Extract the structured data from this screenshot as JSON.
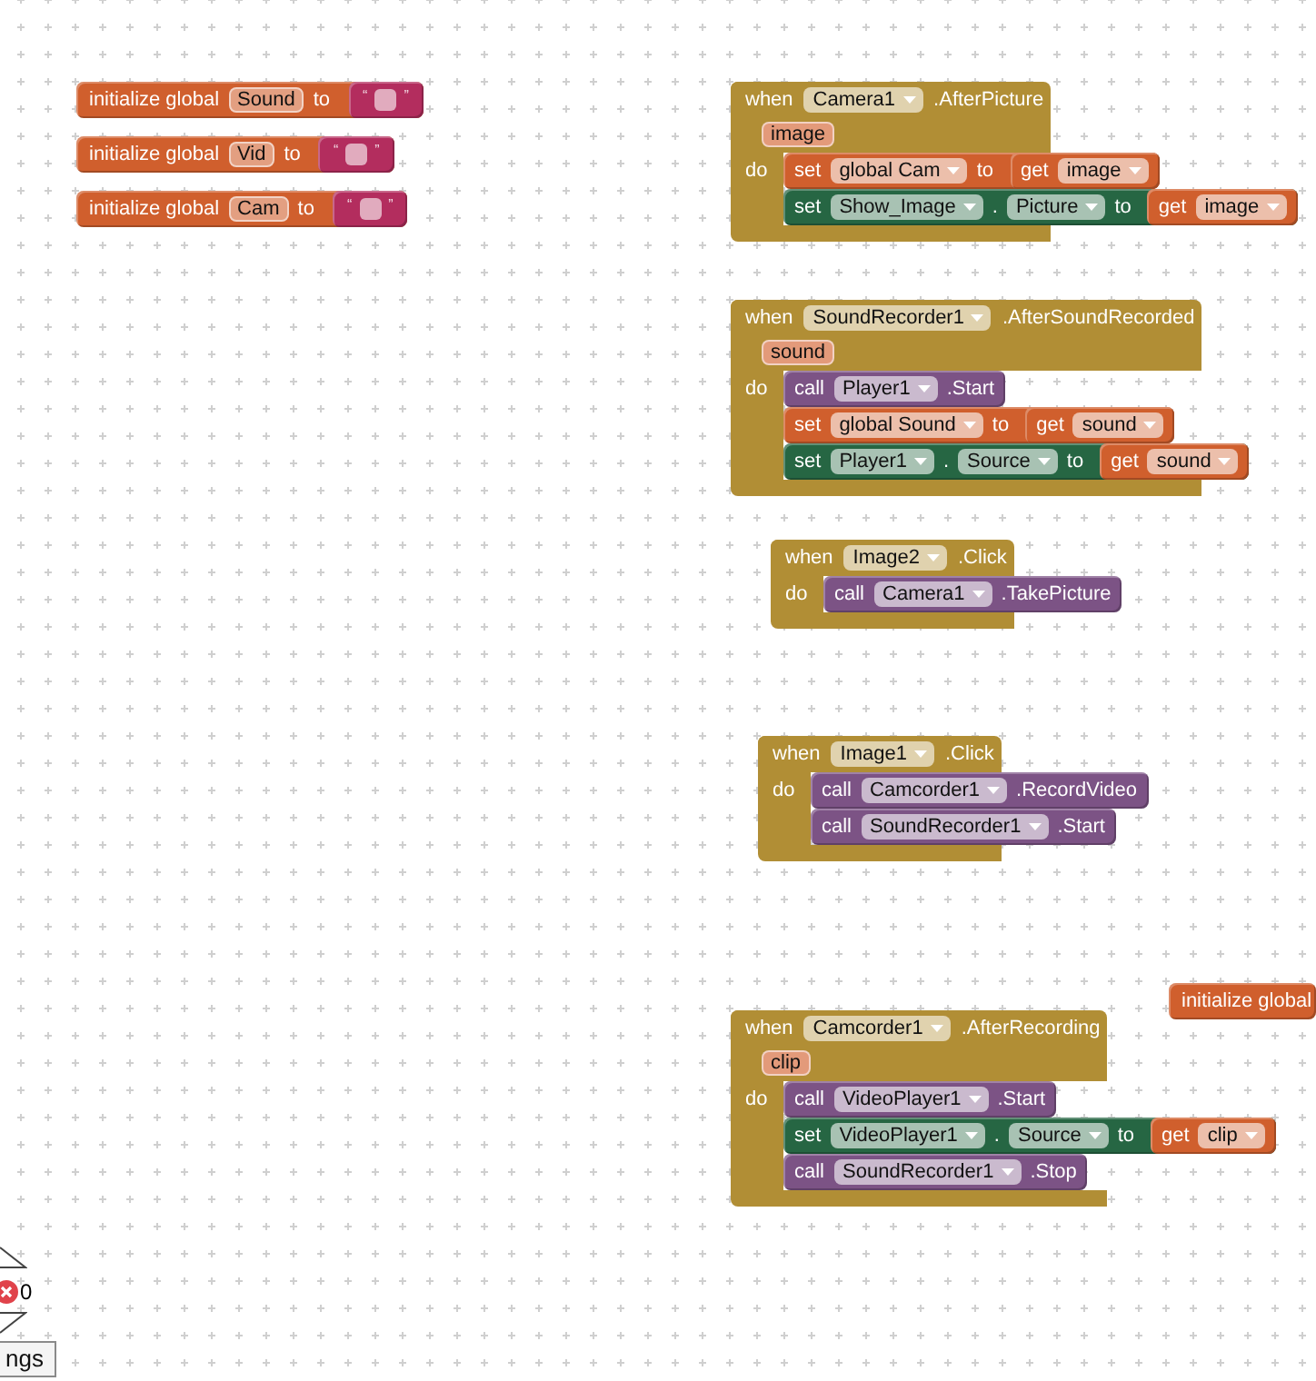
{
  "global_variables": [
    {
      "label": "initialize global",
      "name": "Sound",
      "to": "to",
      "value": {
        "open_quote": "“",
        "close_quote": "”"
      }
    },
    {
      "label": "initialize global",
      "name": "Vid",
      "to": "to",
      "value": {
        "open_quote": "“",
        "close_quote": "”"
      }
    },
    {
      "label": "initialize global",
      "name": "Cam",
      "to": "to",
      "value": {
        "open_quote": "“",
        "close_quote": "”"
      }
    },
    {
      "label": "initialize global"
    }
  ],
  "event_handlers": [
    {
      "when": "when",
      "component": "Camera1",
      "event": ".AfterPicture",
      "params": [
        "image"
      ],
      "do": "do",
      "statements": [
        {
          "kind": "set_global",
          "keyword": "set",
          "variable": "global Cam",
          "to": "to",
          "value": {
            "keyword": "get",
            "variable": "image"
          }
        },
        {
          "kind": "set_property",
          "keyword": "set",
          "component": "Show_Image",
          "dot": ".",
          "property": "Picture",
          "to": "to",
          "value": {
            "keyword": "get",
            "variable": "image"
          }
        }
      ]
    },
    {
      "when": "when",
      "component": "SoundRecorder1",
      "event": ".AfterSoundRecorded",
      "params": [
        "sound"
      ],
      "do": "do",
      "statements": [
        {
          "kind": "call",
          "keyword": "call",
          "component": "Player1",
          "method": ".Start"
        },
        {
          "kind": "set_global",
          "keyword": "set",
          "variable": "global Sound",
          "to": "to",
          "value": {
            "keyword": "get",
            "variable": "sound"
          }
        },
        {
          "kind": "set_property",
          "keyword": "set",
          "component": "Player1",
          "dot": ".",
          "property": "Source",
          "to": "to",
          "value": {
            "keyword": "get",
            "variable": "sound"
          }
        }
      ]
    },
    {
      "when": "when",
      "component": "Image2",
      "event": ".Click",
      "do": "do",
      "statements": [
        {
          "kind": "call",
          "keyword": "call",
          "component": "Camera1",
          "method": ".TakePicture"
        }
      ]
    },
    {
      "when": "when",
      "component": "Image1",
      "event": ".Click",
      "do": "do",
      "statements": [
        {
          "kind": "call",
          "keyword": "call",
          "component": "Camcorder1",
          "method": ".RecordVideo"
        },
        {
          "kind": "call",
          "keyword": "call",
          "component": "SoundRecorder1",
          "method": ".Start"
        }
      ]
    },
    {
      "when": "when",
      "component": "Camcorder1",
      "event": ".AfterRecording",
      "params": [
        "clip"
      ],
      "do": "do",
      "statements": [
        {
          "kind": "call",
          "keyword": "call",
          "component": "VideoPlayer1",
          "method": ".Start"
        },
        {
          "kind": "set_property",
          "keyword": "set",
          "component": "VideoPlayer1",
          "dot": ".",
          "property": "Source",
          "to": "to",
          "value": {
            "keyword": "get",
            "variable": "clip"
          }
        },
        {
          "kind": "call",
          "keyword": "call",
          "component": "SoundRecorder1",
          "method": ".Stop"
        }
      ]
    }
  ],
  "warning_indicator": {
    "error_count": "0",
    "button": "ngs"
  }
}
